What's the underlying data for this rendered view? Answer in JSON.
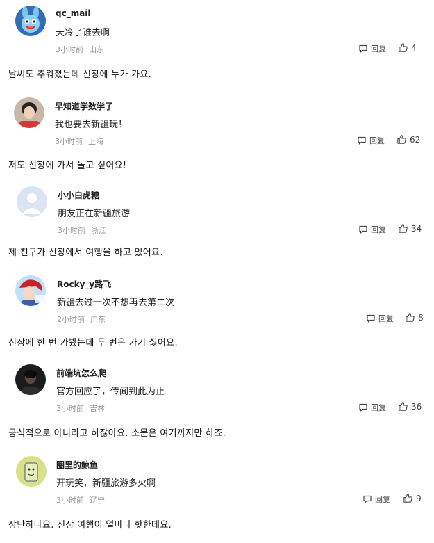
{
  "comments": [
    {
      "username": "qc_mail",
      "text": "天冷了谁去啊",
      "time": "3小时前",
      "location": "山东",
      "reply_label": "回复",
      "likes": "4",
      "avatar": "cartoon-rabbit-avatar",
      "translation": "날씨도 추워졌는데 신장에 누가 가요."
    },
    {
      "username": "早知道学数学了",
      "text": "我也要去新疆玩！",
      "time": "3小时前",
      "location": "上海",
      "reply_label": "回复",
      "likes": "62",
      "avatar": "person-photo-avatar",
      "translation": "저도 신장에 가서 놀고 싶어요!"
    },
    {
      "username": "小小白虎糖",
      "text": "朋友正在新疆旅游",
      "time": "3小时前",
      "location": "浙江",
      "reply_label": "回复",
      "likes": "34",
      "avatar": "default-user-avatar",
      "translation": "제 친구가 신장에서 여행을 하고 있어요."
    },
    {
      "username": "Rocky_y路飞",
      "text": "新疆去过一次不想再去第二次",
      "time": "2小时前",
      "location": "广东",
      "reply_label": "回复",
      "likes": "8",
      "avatar": "anime-avatar",
      "translation": "신장에 한 번 가봤는데 두 번은 가기 싫어요."
    },
    {
      "username": "前端坑怎么爬",
      "text": "官方回应了，传闻到此为止",
      "time": "3小时前",
      "location": "吉林",
      "reply_label": "回复",
      "likes": "36",
      "avatar": "dark-photo-avatar",
      "translation": "공식적으로 아니라고 하잖아요. 소문은 여기까지만 하죠."
    },
    {
      "username": "圈里的鲸鱼",
      "text": "开玩笑，新疆旅游多火啊",
      "time": "3小时前",
      "location": "辽宁",
      "reply_label": "回复",
      "likes": "9",
      "avatar": "drawing-avatar",
      "translation": "장난하나요. 신장 여행이 얼마나 핫한데요."
    }
  ],
  "colors": {
    "meta": "#999999",
    "text": "#222222",
    "default_avatar_bg": "#dbe4f5",
    "default_avatar_fg": "#ffffff"
  }
}
